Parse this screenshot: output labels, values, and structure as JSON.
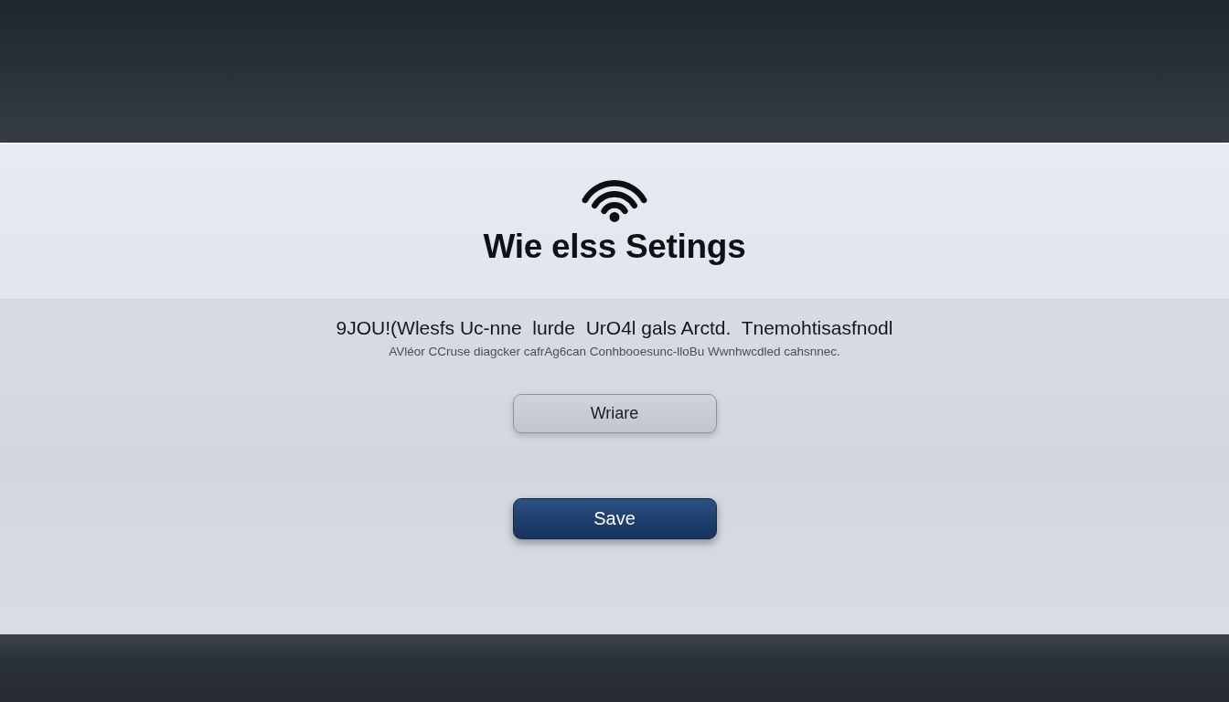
{
  "header": {
    "title": "Wie elss Setings"
  },
  "description": {
    "heading": "9JOU!(Wlesfs Uc-nne  lurde  UrO4l gals Arctd.  Tnemohtisasfnodl",
    "subtext": "AVléor CCruse diagcker cafrAg6can Conhbooesunc-lloBu Wwnhwcdled cahsnnec."
  },
  "buttons": [
    {
      "label": "Wriare",
      "kind": "secondary"
    },
    {
      "label": "Save",
      "kind": "primary"
    }
  ]
}
